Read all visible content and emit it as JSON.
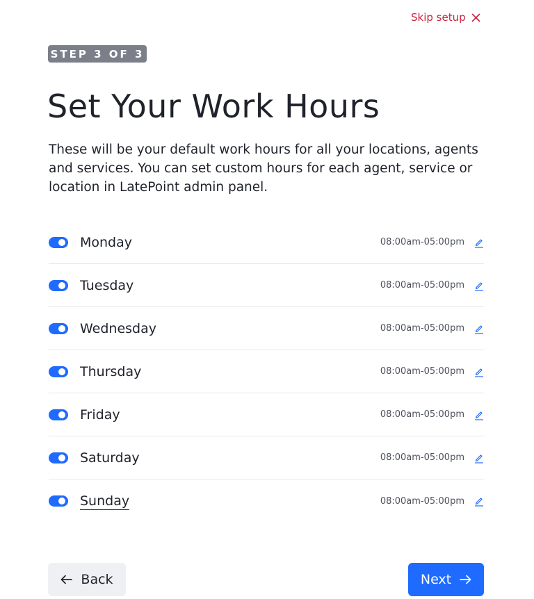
{
  "header": {
    "skip_label": "Skip setup",
    "step_badge": "STEP 3 OF 3",
    "title": "Set Your Work Hours",
    "description": "These will be your default work hours for all your locations, agents and services. You can set custom hours for each agent, service or location in LatePoint admin panel."
  },
  "days": [
    {
      "name": "Monday",
      "hours": "08:00am-05:00pm",
      "enabled": true
    },
    {
      "name": "Tuesday",
      "hours": "08:00am-05:00pm",
      "enabled": true
    },
    {
      "name": "Wednesday",
      "hours": "08:00am-05:00pm",
      "enabled": true
    },
    {
      "name": "Thursday",
      "hours": "08:00am-05:00pm",
      "enabled": true
    },
    {
      "name": "Friday",
      "hours": "08:00am-05:00pm",
      "enabled": true
    },
    {
      "name": "Saturday",
      "hours": "08:00am-05:00pm",
      "enabled": true
    },
    {
      "name": "Sunday",
      "hours": "08:00am-05:00pm",
      "enabled": true
    }
  ],
  "footer": {
    "back_label": "Back",
    "next_label": "Next"
  },
  "colors": {
    "accent": "#1f6bff",
    "skip": "#c9243f",
    "badge": "#7b7f89"
  },
  "icons": {
    "skip": "close-icon",
    "edit": "pencil-icon",
    "back": "arrow-left-icon",
    "next": "arrow-right-icon"
  }
}
